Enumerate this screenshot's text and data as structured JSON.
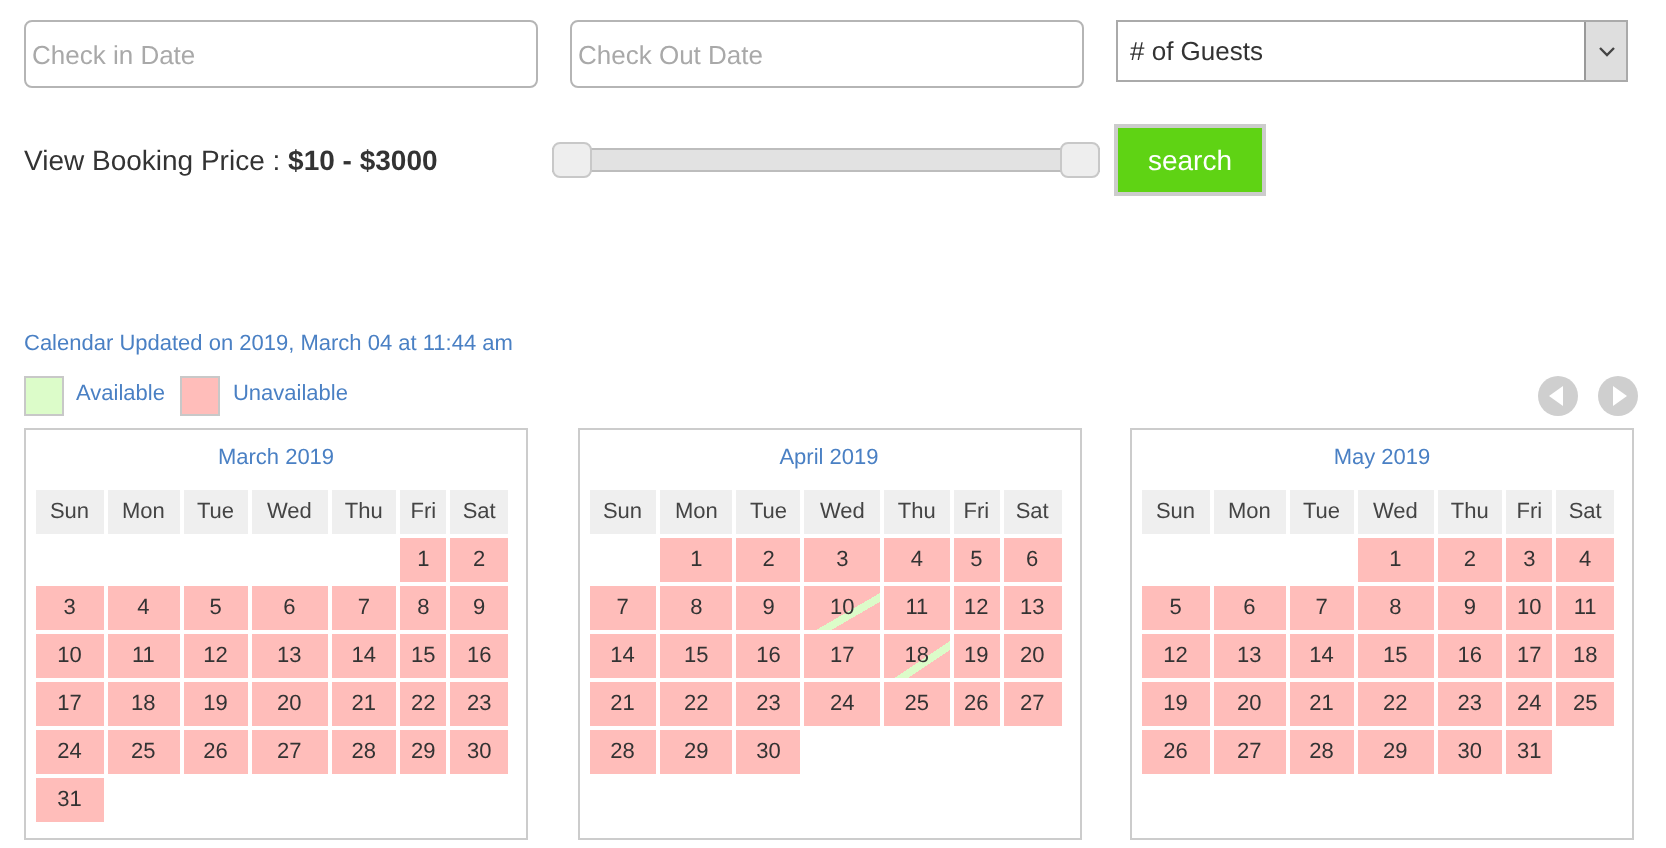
{
  "search_form": {
    "check_in": {
      "placeholder": "Check in Date"
    },
    "check_out": {
      "placeholder": "Check Out Date"
    },
    "guests": {
      "value": "# of Guests"
    },
    "price_label": "View Booking Price : **$10 - $3000**",
    "price_slider": {
      "thumbs": [
        {
          "level": 0
        },
        {
          "level": 1
        }
      ]
    },
    "search_button": "search"
  },
  "calendar_updated": "Calendar Updated on 2019, March 04 at 11:44 am",
  "legend": [
    {
      "label": "Available",
      "color": "#dcfcc9"
    },
    {
      "label": "Unavailable",
      "color": "#ffbdba"
    }
  ],
  "months": [
    {
      "title": "March 2019",
      "weekdays": [
        "Sun",
        "Mon",
        "Tue",
        "Wed",
        "Thu",
        "Fri",
        "Sat"
      ],
      "weeks": [
        [
          {
            "kind": "blank"
          },
          {
            "kind": "blank"
          },
          {
            "kind": "blank"
          },
          {
            "kind": "blank"
          },
          {
            "kind": "blank"
          },
          {
            "day": "1",
            "kind": "unavailable"
          },
          {
            "day": "2",
            "kind": "unavailable"
          }
        ],
        [
          {
            "day": "3",
            "kind": "unavailable"
          },
          {
            "day": "4",
            "kind": "unavailable"
          },
          {
            "day": "5",
            "kind": "unavailable"
          },
          {
            "day": "6",
            "kind": "unavailable"
          },
          {
            "day": "7",
            "kind": "unavailable"
          },
          {
            "day": "8",
            "kind": "unavailable"
          },
          {
            "day": "9",
            "kind": "unavailable"
          }
        ],
        [
          {
            "day": "10",
            "kind": "unavailable"
          },
          {
            "day": "11",
            "kind": "unavailable"
          },
          {
            "day": "12",
            "kind": "unavailable"
          },
          {
            "day": "13",
            "kind": "unavailable"
          },
          {
            "day": "14",
            "kind": "unavailable"
          },
          {
            "day": "15",
            "kind": "unavailable"
          },
          {
            "day": "16",
            "kind": "unavailable"
          }
        ],
        [
          {
            "day": "17",
            "kind": "unavailable"
          },
          {
            "day": "18",
            "kind": "unavailable"
          },
          {
            "day": "19",
            "kind": "unavailable"
          },
          {
            "day": "20",
            "kind": "unavailable"
          },
          {
            "day": "21",
            "kind": "unavailable"
          },
          {
            "day": "22",
            "kind": "unavailable"
          },
          {
            "day": "23",
            "kind": "unavailable"
          }
        ],
        [
          {
            "day": "24",
            "kind": "unavailable"
          },
          {
            "day": "25",
            "kind": "unavailable"
          },
          {
            "day": "26",
            "kind": "unavailable"
          },
          {
            "day": "27",
            "kind": "unavailable"
          },
          {
            "day": "28",
            "kind": "unavailable"
          },
          {
            "day": "29",
            "kind": "unavailable"
          },
          {
            "day": "30",
            "kind": "unavailable"
          }
        ],
        [
          {
            "day": "31",
            "kind": "unavailable"
          },
          {
            "kind": "blank"
          },
          {
            "kind": "blank"
          },
          {
            "kind": "blank"
          },
          {
            "kind": "blank"
          },
          {
            "kind": "blank"
          },
          {
            "kind": "blank"
          }
        ]
      ]
    },
    {
      "title": "April 2019",
      "weekdays": [
        "Sun",
        "Mon",
        "Tue",
        "Wed",
        "Thu",
        "Fri",
        "Sat"
      ],
      "weeks": [
        [
          {
            "kind": "blank"
          },
          {
            "day": "1",
            "kind": "unavailable"
          },
          {
            "day": "2",
            "kind": "unavailable"
          },
          {
            "day": "3",
            "kind": "unavailable"
          },
          {
            "day": "4",
            "kind": "unavailable"
          },
          {
            "day": "5",
            "kind": "unavailable"
          },
          {
            "day": "6",
            "kind": "unavailable"
          }
        ],
        [
          {
            "day": "7",
            "kind": "unavailable"
          },
          {
            "day": "8",
            "kind": "unavailable"
          },
          {
            "day": "9",
            "kind": "unavailable"
          },
          {
            "day": "10",
            "kind": "changeover"
          },
          {
            "day": "11",
            "kind": "unavailable"
          },
          {
            "day": "12",
            "kind": "unavailable"
          },
          {
            "day": "13",
            "kind": "unavailable"
          }
        ],
        [
          {
            "day": "14",
            "kind": "unavailable"
          },
          {
            "day": "15",
            "kind": "unavailable"
          },
          {
            "day": "16",
            "kind": "unavailable"
          },
          {
            "day": "17",
            "kind": "unavailable"
          },
          {
            "day": "18",
            "kind": "changeover"
          },
          {
            "day": "19",
            "kind": "unavailable"
          },
          {
            "day": "20",
            "kind": "unavailable"
          }
        ],
        [
          {
            "day": "21",
            "kind": "unavailable"
          },
          {
            "day": "22",
            "kind": "unavailable"
          },
          {
            "day": "23",
            "kind": "unavailable"
          },
          {
            "day": "24",
            "kind": "unavailable"
          },
          {
            "day": "25",
            "kind": "unavailable"
          },
          {
            "day": "26",
            "kind": "unavailable"
          },
          {
            "day": "27",
            "kind": "unavailable"
          }
        ],
        [
          {
            "day": "28",
            "kind": "unavailable"
          },
          {
            "day": "29",
            "kind": "unavailable"
          },
          {
            "day": "30",
            "kind": "unavailable"
          },
          {
            "kind": "blank"
          },
          {
            "kind": "blank"
          },
          {
            "kind": "blank"
          },
          {
            "kind": "blank"
          }
        ]
      ]
    },
    {
      "title": "May 2019",
      "weekdays": [
        "Sun",
        "Mon",
        "Tue",
        "Wed",
        "Thu",
        "Fri",
        "Sat"
      ],
      "weeks": [
        [
          {
            "kind": "blank"
          },
          {
            "kind": "blank"
          },
          {
            "kind": "blank"
          },
          {
            "day": "1",
            "kind": "unavailable"
          },
          {
            "day": "2",
            "kind": "unavailable"
          },
          {
            "day": "3",
            "kind": "unavailable"
          },
          {
            "day": "4",
            "kind": "unavailable"
          }
        ],
        [
          {
            "day": "5",
            "kind": "unavailable"
          },
          {
            "day": "6",
            "kind": "unavailable"
          },
          {
            "day": "7",
            "kind": "unavailable"
          },
          {
            "day": "8",
            "kind": "unavailable"
          },
          {
            "day": "9",
            "kind": "unavailable"
          },
          {
            "day": "10",
            "kind": "unavailable"
          },
          {
            "day": "11",
            "kind": "unavailable"
          }
        ],
        [
          {
            "day": "12",
            "kind": "unavailable"
          },
          {
            "day": "13",
            "kind": "unavailable"
          },
          {
            "day": "14",
            "kind": "unavailable"
          },
          {
            "day": "15",
            "kind": "unavailable"
          },
          {
            "day": "16",
            "kind": "unavailable"
          },
          {
            "day": "17",
            "kind": "unavailable"
          },
          {
            "day": "18",
            "kind": "unavailable"
          }
        ],
        [
          {
            "day": "19",
            "kind": "unavailable"
          },
          {
            "day": "20",
            "kind": "unavailable"
          },
          {
            "day": "21",
            "kind": "unavailable"
          },
          {
            "day": "22",
            "kind": "unavailable"
          },
          {
            "day": "23",
            "kind": "unavailable"
          },
          {
            "day": "24",
            "kind": "unavailable"
          },
          {
            "day": "25",
            "kind": "unavailable"
          }
        ],
        [
          {
            "day": "26",
            "kind": "unavailable"
          },
          {
            "day": "27",
            "kind": "unavailable"
          },
          {
            "day": "28",
            "kind": "unavailable"
          },
          {
            "day": "29",
            "kind": "unavailable"
          },
          {
            "day": "30",
            "kind": "unavailable"
          },
          {
            "day": "31",
            "kind": "unavailable"
          },
          {
            "kind": "blank"
          }
        ]
      ]
    }
  ]
}
